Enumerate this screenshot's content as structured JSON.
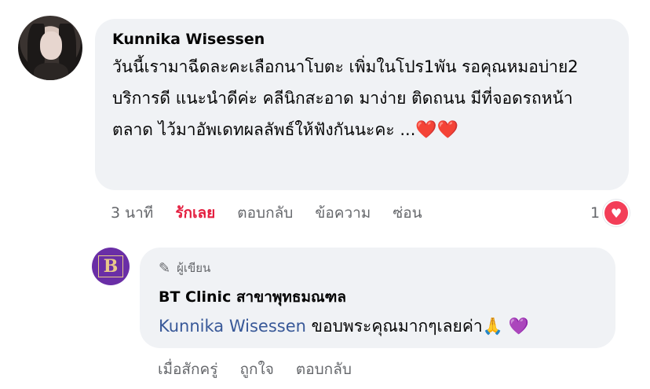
{
  "comment": {
    "author": "Kunnika Wisessen",
    "text": "วันนี้เรามาฉีดละคะเลือกนาโบตะ เพิ่มในโปร1พัน รอคุณหมอบ่าย2 บริการดี แนะนำดีค่ะ คลีนิกสะอาด มาง่าย ติดถนน มีที่จอดรถหน้าตลาด ไว้มาอัพเดทผลลัพธ์ให้ฟังกันนะคะ ...",
    "emoji": "❤️❤️",
    "time": "3 นาที",
    "like_label": "รักเลย",
    "reply_label": "ตอบกลับ",
    "message_label": "ข้อความ",
    "hide_label": "ซ่อน",
    "reaction_count": "1",
    "reaction_icon": "heart-icon"
  },
  "reply": {
    "badge_label": "ผู้เขียน",
    "author": "BT Clinic สาขาพุทธมณฑล",
    "mention": "Kunnika Wisessen",
    "text": "ขอบพระคุณมากๆเลยค่า",
    "emoji_hands": "🙏",
    "emoji_heart": "💜",
    "time": "เมื่อสักครู่",
    "like_label": "ถูกใจ",
    "reply_label": "ตอบกลับ",
    "avatar_letters": "B"
  },
  "colors": {
    "bubble": "#f0f2f5",
    "love": "#e41e3f",
    "secondary_text": "#65676b",
    "mention": "#385898"
  }
}
